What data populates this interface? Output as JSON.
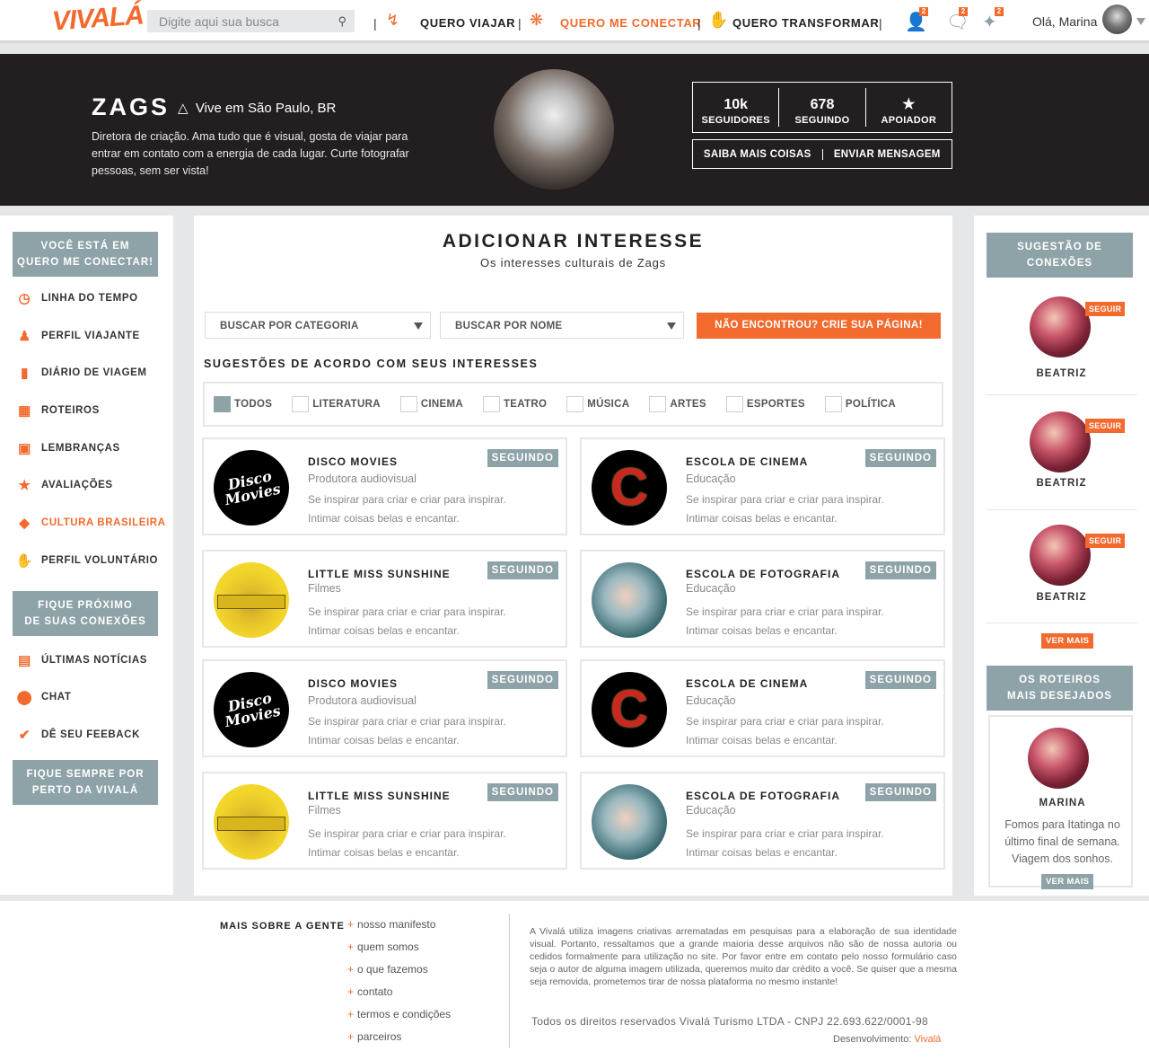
{
  "header": {
    "logo": "VIVALÁ",
    "search_placeholder": "Digite aqui sua busca",
    "nav": [
      "QUERO VIAJAR",
      "QUERO ME CONECTAR",
      "QUERO TRANSFORMAR"
    ],
    "badges": [
      "2",
      "2",
      "2"
    ],
    "greeting": "Olá, Marina",
    "accent": "#f26a2e"
  },
  "profile": {
    "name": "ZAGS",
    "location": "Vive em São Paulo, BR",
    "bio": "Diretora de criação. Ama tudo que é visual, gosta de viajar para entrar em contato com a energia de cada lugar. Curte fotografar pessoas, sem ser vista!",
    "stats": [
      {
        "value": "10k",
        "label": "SEGUIDORES"
      },
      {
        "value": "678",
        "label": "SEGUINDO"
      },
      {
        "value": "★",
        "label": "APOIADOR"
      }
    ],
    "buttons": [
      "SAIBA MAIS COISAS",
      "ENVIAR MENSAGEM"
    ]
  },
  "left_sidebar": {
    "box1": [
      "VOCÊ ESTÁ EM",
      "QUERO ME CONECTAR!"
    ],
    "items1": [
      {
        "label": "LINHA DO TEMPO",
        "icon": "clock-icon"
      },
      {
        "label": "PERFIL VIAJANTE",
        "icon": "person-icon"
      },
      {
        "label": "DIÁRIO DE VIAGEM",
        "icon": "book-icon"
      },
      {
        "label": "ROTEIROS",
        "icon": "map-icon"
      },
      {
        "label": "LEMBRANÇAS",
        "icon": "image-icon"
      },
      {
        "label": "AVALIAÇÕES",
        "icon": "star-icon"
      },
      {
        "label": "CULTURA BRASILEIRA",
        "icon": "brazil-icon"
      },
      {
        "label": "PERFIL VOLUNTÁRIO",
        "icon": "hand-icon"
      }
    ],
    "box2": [
      "FIQUE PRÓXIMO",
      "DE SUAS CONEXÕES"
    ],
    "items2": [
      {
        "label": "ÚLTIMAS NOTÍCIAS",
        "icon": "news-icon"
      },
      {
        "label": "CHAT",
        "icon": "chat-icon"
      },
      {
        "label": "DÊ SEU FEEBACK",
        "icon": "check-icon"
      }
    ],
    "box3": [
      "FIQUE SEMPRE POR",
      "PERTO DA VIVALÁ"
    ]
  },
  "main": {
    "title": "ADICIONAR INTERESSE",
    "subtitle": "Os interesses culturais de Zags",
    "select_category": "BUSCAR POR CATEGORIA",
    "select_name": "BUSCAR POR NOME",
    "create_button": "NÃO ENCONTROU? CRIE SUA PÁGINA!",
    "suggestions_heading": "SUGESTÕES DE ACORDO COM SEUS INTERESSES",
    "filters": [
      "TODOS",
      "LITERATURA",
      "CINEMA",
      "TEATRO",
      "MÚSICA",
      "ARTES",
      "ESPORTES",
      "POLÍTICA"
    ],
    "cards": [
      {
        "title": "DISCO MOVIES",
        "category": "Produtora audiovisual",
        "line1": "Se inspirar para criar e criar para inspirar.",
        "line2": "Intimar coisas belas e encantar.",
        "button": "SEGUINDO",
        "logo_text": "Disco Movies"
      },
      {
        "title": "ESCOLA DE CINEMA",
        "category": "Educação",
        "line1": "Se inspirar para criar e criar para inspirar.",
        "line2": "Intimar coisas belas e encantar.",
        "button": "SEGUINDO",
        "logo_text": "C"
      },
      {
        "title": "LITTLE MISS SUNSHINE",
        "category": "Filmes",
        "line1": "Se inspirar para criar e criar para inspirar.",
        "line2": "Intimar coisas belas e encantar.",
        "button": "SEGUINDO",
        "logo_text": ""
      },
      {
        "title": "ESCOLA DE FOTOGRAFIA",
        "category": "Educação",
        "line1": "Se inspirar para criar e criar para inspirar.",
        "line2": "Intimar coisas belas e encantar.",
        "button": "SEGUINDO",
        "logo_text": ""
      },
      {
        "title": "DISCO MOVIES",
        "category": "Produtora audiovisual",
        "line1": "Se inspirar para criar e criar para inspirar.",
        "line2": "Intimar coisas belas e encantar.",
        "button": "SEGUINDO",
        "logo_text": "Disco Movies"
      },
      {
        "title": "ESCOLA DE CINEMA",
        "category": "Educação",
        "line1": "Se inspirar para criar e criar para inspirar.",
        "line2": "Intimar coisas belas e encantar.",
        "button": "SEGUINDO",
        "logo_text": "C"
      },
      {
        "title": "LITTLE MISS SUNSHINE",
        "category": "Filmes",
        "line1": "Se inspirar para criar e criar para inspirar.",
        "line2": "Intimar coisas belas e encantar.",
        "button": "SEGUINDO",
        "logo_text": ""
      },
      {
        "title": "ESCOLA DE FOTOGRAFIA",
        "category": "Educação",
        "line1": "Se inspirar para criar e criar para inspirar.",
        "line2": "Intimar coisas belas e encantar.",
        "button": "SEGUINDO",
        "logo_text": ""
      }
    ]
  },
  "right_sidebar": {
    "box1": [
      "SUGESTÃO DE",
      "CONEXÕES"
    ],
    "suggestions": [
      {
        "name": "BEATRIZ",
        "follow": "SEGUIR"
      },
      {
        "name": "BEATRIZ",
        "follow": "SEGUIR"
      },
      {
        "name": "BEATRIZ",
        "follow": "SEGUIR"
      }
    ],
    "more1": "VER MAIS",
    "box2": [
      "OS ROTEIROS",
      "MAIS DESEJADOS"
    ],
    "route": {
      "name": "MARINA",
      "desc": "Fomos para Itatinga no último final de semana. Viagem dos sonhos."
    },
    "more2": "VER MAIS"
  },
  "footer": {
    "heading": "MAIS SOBRE A GENTE",
    "links": [
      "nosso manifesto",
      "quem somos",
      "o que fazemos",
      "contato",
      "termos e condições",
      "parceiros"
    ],
    "text": "A Vivalá utiliza imagens criativas arrematadas em pesquisas para a elaboração de sua identidade visual. Portanto, ressaltamos que a grande maioria desse arquivos não são de nossa autoria ou cedidos formalmente para utilização no site. Por favor entre em contato pelo nosso formulário caso seja o autor de alguma imagem utilizada, queremos muito dar crédito a você. Se quiser que a mesma seja removida, prometemos tirar de nossa plataforma no mesmo instante!",
    "copyright": "Todos os direitos reservados Vivalá Turismo LTDA   -  CNPJ 22.693.622/0001-98",
    "dev_label": "Desenvolvimento:",
    "dev_name": "Vivalá"
  }
}
